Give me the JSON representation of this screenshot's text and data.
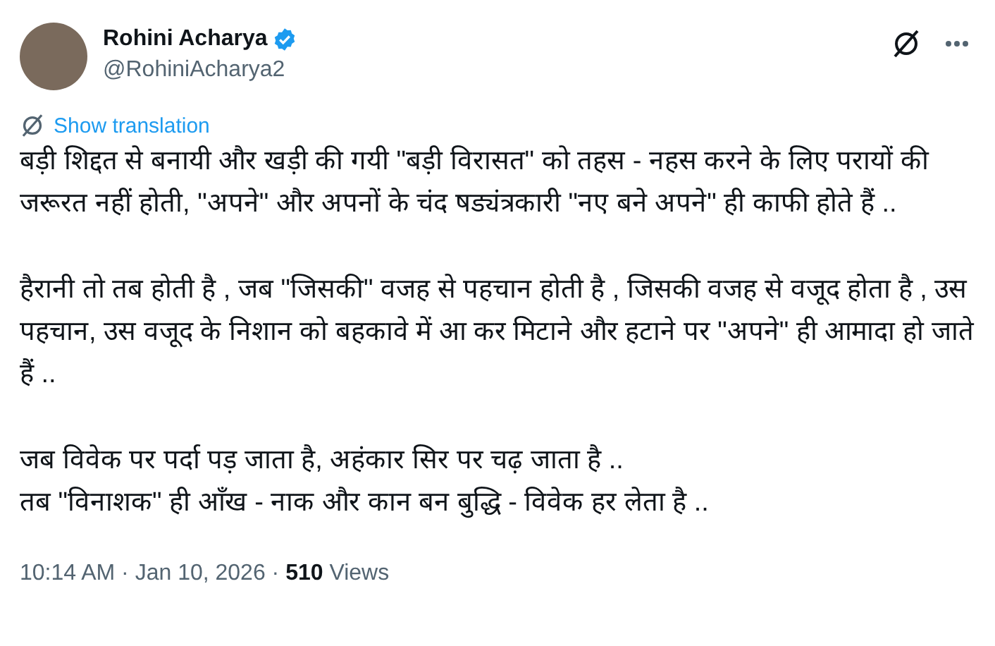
{
  "author": {
    "name": "Rohini Acharya",
    "verified": true,
    "handle": "@RohiniAcharya2"
  },
  "translation_link": "Show translation",
  "paragraphs": [
    [
      "बड़ी शिद्दत से बनायी और खड़ी की गयी \"बड़ी विरासत\" को तहस - नहस करने के लिए परायों की जरूरत नहीं होती, \"अपने\" और अपनों के चंद षड्यंत्रकारी \"नए बने अपने\" ही काफी होते हैं .."
    ],
    [
      "हैरानी तो तब होती है , जब \"जिसकी\" वजह से पहचान होती है , जिसकी वजह से वजूद होता है , उस पहचान, उस वजूद के निशान को बहकावे में आ कर मिटाने और हटाने पर \"अपने\" ही आमादा हो जाते हैं .."
    ],
    [
      "जब विवेक पर पर्दा पड़ जाता है, अहंकार सिर पर चढ़ जाता है ..",
      "तब \"विनाशक\" ही आँख - नाक और कान बन बुद्धि - विवेक हर लेता है .."
    ]
  ],
  "meta": "10:14 AM · Jan 10, 2026 · **510** Views"
}
